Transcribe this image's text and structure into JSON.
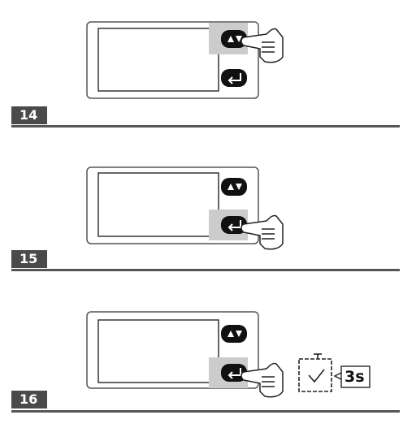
{
  "steps": [
    {
      "number": "14",
      "pressed_button": "up-down",
      "show_timer": false
    },
    {
      "number": "15",
      "pressed_button": "enter",
      "show_timer": false
    },
    {
      "number": "16",
      "pressed_button": "enter",
      "show_timer": true
    }
  ],
  "timer": {
    "label": "3s",
    "icon": "stopwatch-icon"
  },
  "icons": {
    "arrows_button": "up-down-arrows-icon",
    "enter_button": "enter-return-icon",
    "hand": "pointing-hand-icon"
  }
}
